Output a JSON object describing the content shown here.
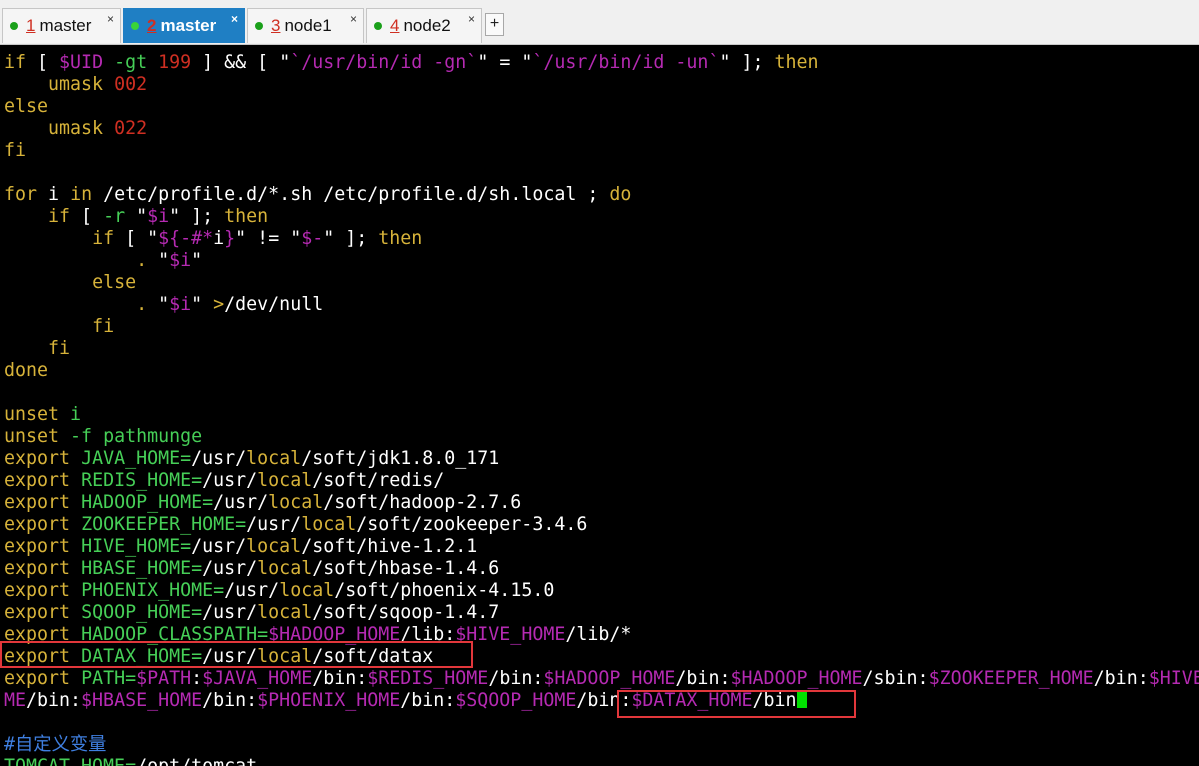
{
  "tabs": [
    {
      "num": "1",
      "label": "master",
      "active": false
    },
    {
      "num": "2",
      "label": "master",
      "active": true
    },
    {
      "num": "3",
      "label": "node1",
      "active": false
    },
    {
      "num": "4",
      "label": "node2",
      "active": false
    }
  ],
  "new_tab_symbol": "+",
  "close_symbol": "×",
  "colors": {
    "keyword": "#d7b33a",
    "command_green": "#46cf57",
    "number_red": "#cf2f22",
    "string_magenta": "#b52ab2",
    "comment_blue": "#3f7fe0",
    "highlight_box": "#e2373b",
    "cursor": "#00e000",
    "tab_active": "#1f7fc4"
  },
  "lines": [
    [
      [
        "kw",
        "if"
      ],
      [
        "wht",
        " [ "
      ],
      [
        "var",
        "$UID"
      ],
      [
        "grn",
        " -gt "
      ],
      [
        "num",
        "199"
      ],
      [
        "wht",
        " ] && [ \""
      ],
      [
        "str",
        "`/usr/bin/id -gn`"
      ],
      [
        "wht",
        "\" = \""
      ],
      [
        "str",
        "`/usr/bin/id -un`"
      ],
      [
        "wht",
        "\" ]; "
      ],
      [
        "kw",
        "then"
      ]
    ],
    [
      [
        "wht",
        "    "
      ],
      [
        "kw",
        "umask"
      ],
      [
        "wht",
        " "
      ],
      [
        "num",
        "002"
      ]
    ],
    [
      [
        "kw",
        "else"
      ]
    ],
    [
      [
        "wht",
        "    "
      ],
      [
        "kw",
        "umask"
      ],
      [
        "wht",
        " "
      ],
      [
        "num",
        "022"
      ]
    ],
    [
      [
        "kw",
        "fi"
      ]
    ],
    [],
    [
      [
        "kw",
        "for"
      ],
      [
        "wht",
        " i "
      ],
      [
        "kw",
        "in"
      ],
      [
        "wht",
        " /etc/profile.d/*.sh /etc/profile.d/sh.local ; "
      ],
      [
        "kw",
        "do"
      ]
    ],
    [
      [
        "wht",
        "    "
      ],
      [
        "kw",
        "if"
      ],
      [
        "wht",
        " [ "
      ],
      [
        "grn",
        "-r"
      ],
      [
        "wht",
        " \""
      ],
      [
        "var",
        "$i"
      ],
      [
        "wht",
        "\" ]; "
      ],
      [
        "kw",
        "then"
      ]
    ],
    [
      [
        "wht",
        "        "
      ],
      [
        "kw",
        "if"
      ],
      [
        "wht",
        " [ \""
      ],
      [
        "var",
        "${-#*"
      ],
      [
        "wht",
        "i"
      ],
      [
        "var",
        "}"
      ],
      [
        "wht",
        "\" != \""
      ],
      [
        "var",
        "$-"
      ],
      [
        "wht",
        "\" ]; "
      ],
      [
        "kw",
        "then"
      ]
    ],
    [
      [
        "wht",
        "            "
      ],
      [
        "kw",
        "."
      ],
      [
        "wht",
        " \""
      ],
      [
        "var",
        "$i"
      ],
      [
        "wht",
        "\""
      ]
    ],
    [
      [
        "wht",
        "        "
      ],
      [
        "kw",
        "else"
      ]
    ],
    [
      [
        "wht",
        "            "
      ],
      [
        "kw",
        "."
      ],
      [
        "wht",
        " \""
      ],
      [
        "var",
        "$i"
      ],
      [
        "wht",
        "\" "
      ],
      [
        "kw",
        ">"
      ],
      [
        "wht",
        "/dev/null"
      ]
    ],
    [
      [
        "wht",
        "        "
      ],
      [
        "kw",
        "fi"
      ]
    ],
    [
      [
        "wht",
        "    "
      ],
      [
        "kw",
        "fi"
      ]
    ],
    [
      [
        "kw",
        "done"
      ]
    ],
    [],
    [
      [
        "kw",
        "unset"
      ],
      [
        "wht",
        " "
      ],
      [
        "grn",
        "i"
      ]
    ],
    [
      [
        "kw",
        "unset"
      ],
      [
        "wht",
        " "
      ],
      [
        "grn",
        "-f"
      ],
      [
        "wht",
        " "
      ],
      [
        "grn",
        "pathmunge"
      ]
    ],
    [
      [
        "kw",
        "export"
      ],
      [
        "wht",
        " "
      ],
      [
        "grn",
        "JAVA_HOME="
      ],
      [
        "wht",
        "/usr/"
      ],
      [
        "kw",
        "local"
      ],
      [
        "wht",
        "/soft/jdk1.8.0_171"
      ]
    ],
    [
      [
        "kw",
        "export"
      ],
      [
        "wht",
        " "
      ],
      [
        "grn",
        "REDIS_HOME="
      ],
      [
        "wht",
        "/usr/"
      ],
      [
        "kw",
        "local"
      ],
      [
        "wht",
        "/soft/redis/"
      ]
    ],
    [
      [
        "kw",
        "export"
      ],
      [
        "wht",
        " "
      ],
      [
        "grn",
        "HADOOP_HOME="
      ],
      [
        "wht",
        "/usr/"
      ],
      [
        "kw",
        "local"
      ],
      [
        "wht",
        "/soft/hadoop-2.7.6"
      ]
    ],
    [
      [
        "kw",
        "export"
      ],
      [
        "wht",
        " "
      ],
      [
        "grn",
        "ZOOKEEPER_HOME="
      ],
      [
        "wht",
        "/usr/"
      ],
      [
        "kw",
        "local"
      ],
      [
        "wht",
        "/soft/zookeeper-3.4.6"
      ]
    ],
    [
      [
        "kw",
        "export"
      ],
      [
        "wht",
        " "
      ],
      [
        "grn",
        "HIVE_HOME="
      ],
      [
        "wht",
        "/usr/"
      ],
      [
        "kw",
        "local"
      ],
      [
        "wht",
        "/soft/hive-1.2.1"
      ]
    ],
    [
      [
        "kw",
        "export"
      ],
      [
        "wht",
        " "
      ],
      [
        "grn",
        "HBASE_HOME="
      ],
      [
        "wht",
        "/usr/"
      ],
      [
        "kw",
        "local"
      ],
      [
        "wht",
        "/soft/hbase-1.4.6"
      ]
    ],
    [
      [
        "kw",
        "export"
      ],
      [
        "wht",
        " "
      ],
      [
        "grn",
        "PHOENIX_HOME="
      ],
      [
        "wht",
        "/usr/"
      ],
      [
        "kw",
        "local"
      ],
      [
        "wht",
        "/soft/phoenix-4.15.0"
      ]
    ],
    [
      [
        "kw",
        "export"
      ],
      [
        "wht",
        " "
      ],
      [
        "grn",
        "SQOOP_HOME="
      ],
      [
        "wht",
        "/usr/"
      ],
      [
        "kw",
        "local"
      ],
      [
        "wht",
        "/soft/sqoop-1.4.7"
      ]
    ],
    [
      [
        "kw",
        "export"
      ],
      [
        "wht",
        " "
      ],
      [
        "grn",
        "HADOOP_CLASSPATH="
      ],
      [
        "var",
        "$HADOOP_HOME"
      ],
      [
        "wht",
        "/lib:"
      ],
      [
        "var",
        "$HIVE_HOME"
      ],
      [
        "wht",
        "/lib/*"
      ]
    ],
    [
      [
        "kw",
        "export"
      ],
      [
        "wht",
        " "
      ],
      [
        "grn",
        "DATAX_HOME="
      ],
      [
        "wht",
        "/usr/"
      ],
      [
        "kw",
        "local"
      ],
      [
        "wht",
        "/soft/datax"
      ]
    ],
    [
      [
        "kw",
        "export"
      ],
      [
        "wht",
        " "
      ],
      [
        "grn",
        "PATH="
      ],
      [
        "var",
        "$PATH"
      ],
      [
        "wht",
        ":"
      ],
      [
        "var",
        "$JAVA_HOME"
      ],
      [
        "wht",
        "/bin:"
      ],
      [
        "var",
        "$REDIS_HOME"
      ],
      [
        "wht",
        "/bin:"
      ],
      [
        "var",
        "$HADOOP_HOME"
      ],
      [
        "wht",
        "/bin:"
      ],
      [
        "var",
        "$HADOOP_HOME"
      ],
      [
        "wht",
        "/sbin:"
      ],
      [
        "var",
        "$ZOOKEEPER_HOME"
      ],
      [
        "wht",
        "/bin:"
      ],
      [
        "var",
        "$HIVE_HO"
      ]
    ],
    [
      [
        "var",
        "ME"
      ],
      [
        "wht",
        "/bin:"
      ],
      [
        "var",
        "$HBASE_HOME"
      ],
      [
        "wht",
        "/bin:"
      ],
      [
        "var",
        "$PHOENIX_HOME"
      ],
      [
        "wht",
        "/bin:"
      ],
      [
        "var",
        "$SQOOP_HOME"
      ],
      [
        "wht",
        "/bin:"
      ],
      [
        "var",
        "$DATAX_HOME"
      ],
      [
        "wht",
        "/bin"
      ]
    ],
    [],
    [
      [
        "cmt",
        "#自定义变量"
      ]
    ],
    [
      [
        "grn",
        "TOMCAT_HOME="
      ],
      [
        "wht",
        "/opt/tomcat"
      ]
    ]
  ]
}
